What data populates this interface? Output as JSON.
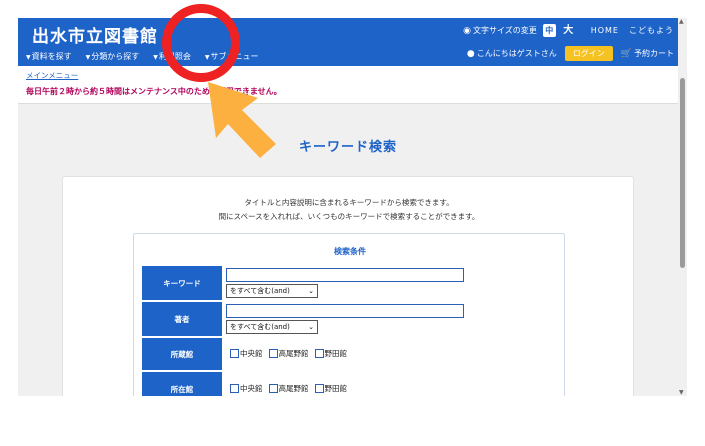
{
  "header": {
    "site_title": "出水市立図書館",
    "nav": [
      "資料を探す",
      "分類から探す",
      "利用照会",
      "サブメニュー"
    ],
    "text_size_label": "文字サイズの変更",
    "text_size_mid": "中",
    "text_size_big": "大",
    "home_link": "HOME",
    "kids_link": "こどもよう",
    "greeting": "こんにちはゲストさん",
    "login_label": "ログイン",
    "cart_label": "予約カート"
  },
  "subbar": {
    "breadcrumb": "メインメニュー",
    "notice": "毎日午前２時から約５時間はメンテナンス中のためご利用できません。"
  },
  "main": {
    "title": "キーワード検索",
    "desc_line1": "タイトルと内容説明に含まれるキーワードから検索できます。",
    "desc_line2": "間にスペースを入れれば、いくつものキーワードで検索することができます。",
    "conditions_title": "検索条件",
    "rows": {
      "keyword_label": "キーワード",
      "keyword_value": "",
      "keyword_mode": "をすべて含む(and)",
      "author_label": "著者",
      "author_value": "",
      "author_mode": "をすべて含む(and)",
      "holding_label": "所蔵館",
      "location_label": "所在館",
      "libraries": [
        "中央館",
        "高尾野館",
        "野田館"
      ]
    }
  },
  "colors": {
    "brand": "#1e63c8",
    "login": "#f5c222",
    "notice": "#b0005a",
    "annotation_circle": "#ee2222",
    "annotation_arrow": "#fbb040"
  },
  "icons": {
    "text_size": "person-circle-icon",
    "user": "user-icon",
    "cart": "cart-icon"
  }
}
